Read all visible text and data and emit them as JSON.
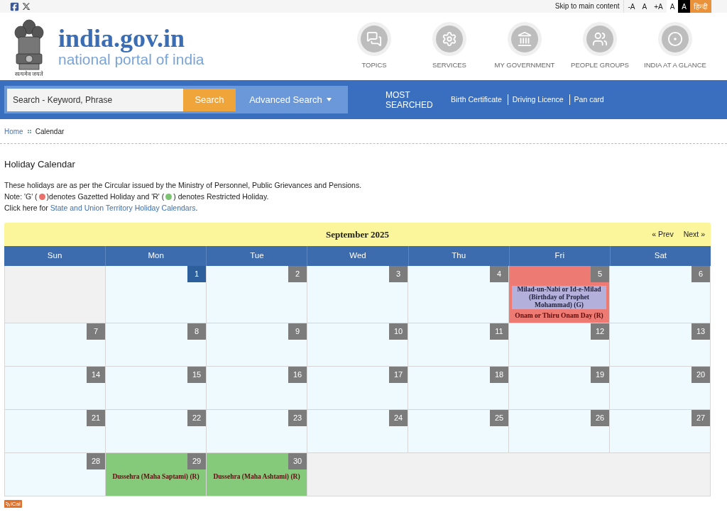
{
  "top_bar": {
    "skip_link": "Skip to main content",
    "text_controls": [
      {
        "label": "-A",
        "kind": "size"
      },
      {
        "label": "A",
        "kind": "size"
      },
      {
        "label": "+A",
        "kind": "size"
      },
      {
        "label": "A",
        "kind": "light"
      },
      {
        "label": "A",
        "kind": "dark"
      },
      {
        "label": "हिन्दी",
        "kind": "language"
      }
    ]
  },
  "header": {
    "motto": "सत्यमेव जयते",
    "site_name": "india.gov.in",
    "tagline": "national portal of india",
    "nav": [
      {
        "label": "TOPICS",
        "kind": "chat"
      },
      {
        "label": "SERVICES",
        "kind": "gear"
      },
      {
        "label": "MY GOVERNMENT",
        "kind": "building"
      },
      {
        "label": "PEOPLE GROUPS",
        "kind": "people"
      },
      {
        "label": "INDIA AT A GLANCE",
        "kind": "circle"
      }
    ]
  },
  "search_bar": {
    "placeholder": "Search - Keyword, Phrase",
    "button": "Search",
    "advanced": "Advanced Search",
    "most_searched_label": "MOST SEARCHED",
    "most_searched": [
      "Birth Certificate",
      "Driving Licence",
      "Pan card"
    ]
  },
  "breadcrumb": [
    "Home",
    "Calendar"
  ],
  "page_title": "Holiday Calendar",
  "intro": "These holidays are as per the Circular issued by the Ministry of Personnel, Public Grievances and Pensions.",
  "note": [
    {
      "kind": "text",
      "text": "Note: 'G' ("
    },
    {
      "kind": "dot",
      "color": "#e8716c"
    },
    {
      "kind": "text",
      "text": ")denotes Gazetted Holiday and 'R' ("
    },
    {
      "kind": "dot",
      "color": "#7cc472"
    },
    {
      "kind": "text",
      "text": ") denotes Restricted Holiday."
    }
  ],
  "click_line": {
    "before": "Click here for ",
    "link": "State and Union Territory Holiday Calendars",
    "after": "."
  },
  "calendar": {
    "title": "September 2025",
    "prev": "« Prev",
    "next": "Next »",
    "weekdays": [
      "Sun",
      "Mon",
      "Tue",
      "Wed",
      "Thu",
      "Fri",
      "Sat"
    ],
    "weeks": [
      [
        {
          "kind": "empty"
        },
        {
          "kind": "day",
          "day": "1",
          "today": true
        },
        {
          "kind": "day",
          "day": "2",
          "today": false
        },
        {
          "kind": "day",
          "day": "3",
          "today": false
        },
        {
          "kind": "day",
          "day": "4",
          "today": false
        },
        {
          "kind": "day",
          "day": "5",
          "today": false,
          "holidays": [
            {
              "name": "Milad-un-Nabi or Id-e-Milad (Birthday of Prophet Mohammad) (G)",
              "kind": "gazetted",
              "selected": true
            },
            {
              "name": "Onam or Thiru Onam Day (R)",
              "kind": "restricted",
              "selected": false
            }
          ]
        },
        {
          "kind": "day",
          "day": "6",
          "today": false
        }
      ],
      [
        {
          "kind": "day",
          "day": "7",
          "today": false
        },
        {
          "kind": "day",
          "day": "8",
          "today": false
        },
        {
          "kind": "day",
          "day": "9",
          "today": false
        },
        {
          "kind": "day",
          "day": "10",
          "today": false
        },
        {
          "kind": "day",
          "day": "11",
          "today": false
        },
        {
          "kind": "day",
          "day": "12",
          "today": false
        },
        {
          "kind": "day",
          "day": "13",
          "today": false
        }
      ],
      [
        {
          "kind": "day",
          "day": "14",
          "today": false
        },
        {
          "kind": "day",
          "day": "15",
          "today": false
        },
        {
          "kind": "day",
          "day": "16",
          "today": false
        },
        {
          "kind": "day",
          "day": "17",
          "today": false
        },
        {
          "kind": "day",
          "day": "18",
          "today": false
        },
        {
          "kind": "day",
          "day": "19",
          "today": false
        },
        {
          "kind": "day",
          "day": "20",
          "today": false
        }
      ],
      [
        {
          "kind": "day",
          "day": "21",
          "today": false
        },
        {
          "kind": "day",
          "day": "22",
          "today": false
        },
        {
          "kind": "day",
          "day": "23",
          "today": false
        },
        {
          "kind": "day",
          "day": "24",
          "today": false
        },
        {
          "kind": "day",
          "day": "25",
          "today": false
        },
        {
          "kind": "day",
          "day": "26",
          "today": false
        },
        {
          "kind": "day",
          "day": "27",
          "today": false
        }
      ],
      [
        {
          "kind": "day",
          "day": "28",
          "today": false
        },
        {
          "kind": "day",
          "day": "29",
          "today": false,
          "holidays": [
            {
              "name": "Dussehra (Maha Saptami) (R)",
              "kind": "restricted",
              "selected": false
            }
          ]
        },
        {
          "kind": "day",
          "day": "30",
          "today": false,
          "holidays": [
            {
              "name": "Dussehra (Maha Ashtami) (R)",
              "kind": "restricted",
              "selected": false
            }
          ]
        },
        {
          "kind": "blank"
        },
        {
          "kind": "blank"
        },
        {
          "kind": "blank"
        },
        {
          "kind": "blank"
        }
      ]
    ]
  },
  "ical": "iCal"
}
